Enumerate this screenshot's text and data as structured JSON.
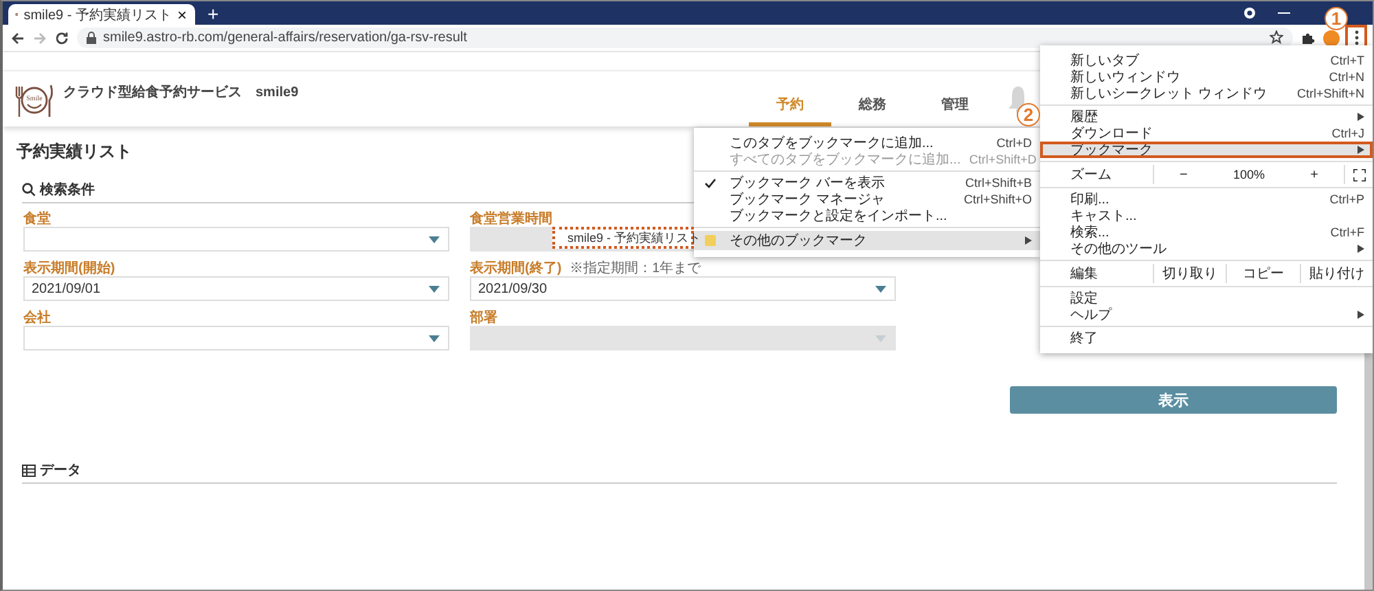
{
  "browser": {
    "tab": {
      "title": "smile9 - 予約実績リスト",
      "close": "×"
    },
    "new_tab": "+",
    "url": "smile9.astro-rb.com/general-affairs/reservation/ga-rsv-result",
    "menu_button": {
      "highlighted": true
    }
  },
  "header": {
    "title": "クラウド型給食予約サービス　smile9",
    "logo_text": "Smile",
    "nav": [
      {
        "label": "予約",
        "selected": true
      },
      {
        "label": "総務",
        "selected": false
      },
      {
        "label": "管理",
        "selected": false
      }
    ]
  },
  "page": {
    "title": "予約実績リスト",
    "search_section": "検索条件",
    "fields": [
      {
        "label": "食堂",
        "disabled": false
      },
      {
        "label": "食堂営業時間",
        "disabled": true
      },
      {
        "label": "表示期間(開始)",
        "value": "2021/09/01",
        "disabled": false
      },
      {
        "label": "表示期間(終了)",
        "note": "※指定期間：1年まで",
        "value": "2021/09/30",
        "disabled": false
      },
      {
        "label": "会社",
        "disabled": false
      },
      {
        "label": "部署",
        "disabled": true
      }
    ],
    "submit": "表示",
    "data_section": "データ"
  },
  "menu": {
    "groups": [
      [
        {
          "kind": "item",
          "label": "新しいタブ",
          "shortcut": "Ctrl+T",
          "submenu": false,
          "selected": false
        },
        {
          "kind": "item",
          "label": "新しいウィンドウ",
          "shortcut": "Ctrl+N",
          "submenu": false,
          "selected": false
        },
        {
          "kind": "item",
          "label": "新しいシークレット ウィンドウ",
          "shortcut": "Ctrl+Shift+N",
          "submenu": false,
          "selected": false
        }
      ],
      [
        {
          "kind": "item",
          "label": "履歴",
          "submenu": true,
          "selected": false
        },
        {
          "kind": "item",
          "label": "ダウンロード",
          "shortcut": "Ctrl+J",
          "submenu": false,
          "selected": false
        },
        {
          "kind": "item",
          "label": "ブックマーク",
          "submenu": true,
          "selected": true
        }
      ],
      [
        {
          "kind": "zoom",
          "label": "ズーム",
          "minus": "−",
          "value": "100%",
          "plus": "+"
        }
      ],
      [
        {
          "kind": "item",
          "label": "印刷...",
          "shortcut": "Ctrl+P",
          "submenu": false,
          "selected": false
        },
        {
          "kind": "item",
          "label": "キャスト...",
          "submenu": false,
          "selected": false
        },
        {
          "kind": "item",
          "label": "検索...",
          "shortcut": "Ctrl+F",
          "submenu": false,
          "selected": false
        },
        {
          "kind": "item",
          "label": "その他のツール",
          "submenu": true,
          "selected": false
        }
      ],
      [
        {
          "kind": "edit",
          "label": "編集",
          "buttons": [
            "切り取り",
            "コピー",
            "貼り付け"
          ]
        }
      ],
      [
        {
          "kind": "item",
          "label": "設定",
          "submenu": false,
          "selected": false
        },
        {
          "kind": "item",
          "label": "ヘルプ",
          "submenu": true,
          "selected": false
        }
      ],
      [
        {
          "kind": "item",
          "label": "終了",
          "submenu": false,
          "selected": false
        }
      ]
    ]
  },
  "submenu": {
    "groups": [
      [
        {
          "kind": "item",
          "label": "このタブをブックマークに追加...",
          "shortcut": "Ctrl+D",
          "checked": false,
          "disabled": false,
          "selected": false
        },
        {
          "kind": "item",
          "label": "すべてのタブをブックマークに追加...",
          "shortcut": "Ctrl+Shift+D",
          "checked": false,
          "disabled": true,
          "selected": false
        }
      ],
      [
        {
          "kind": "item",
          "label": "ブックマーク バーを表示",
          "shortcut": "Ctrl+Shift+B",
          "checked": true,
          "disabled": false,
          "selected": false
        },
        {
          "kind": "item",
          "label": "ブックマーク マネージャ",
          "shortcut": "Ctrl+Shift+O",
          "checked": false,
          "disabled": false,
          "selected": false
        },
        {
          "kind": "item",
          "label": "ブックマークと設定をインポート...",
          "checked": false,
          "disabled": false,
          "selected": false
        }
      ],
      [
        {
          "kind": "folder",
          "label": "その他のブックマーク",
          "disabled": false,
          "selected": true
        }
      ]
    ]
  },
  "dragged_bookmark": {
    "label": "smile9 - 予約実績リスト"
  },
  "annotations": [
    {
      "label": "1"
    },
    {
      "label": "2"
    }
  ]
}
